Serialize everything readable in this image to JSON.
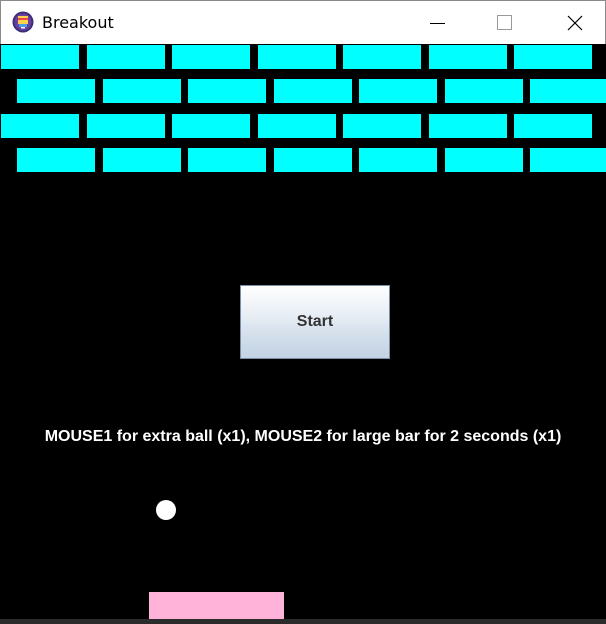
{
  "window": {
    "title": "Breakout",
    "icon": "breakout-app-icon",
    "controls": {
      "minimize_icon": "minimize-icon",
      "maximize_icon": "maximize-icon",
      "close_icon": "close-icon"
    }
  },
  "game": {
    "start_label": "Start",
    "hint_text": "MOUSE1 for extra ball (x1), MOUSE2 for large bar for 2 seconds (x1)",
    "brick_rows": 4,
    "bricks_per_row": [
      7,
      7,
      7,
      7
    ],
    "colors": {
      "background": "#000000",
      "brick": "#00ffff",
      "ball": "#ffffff",
      "paddle": "#ffb3d9",
      "text": "#ffffff"
    }
  }
}
